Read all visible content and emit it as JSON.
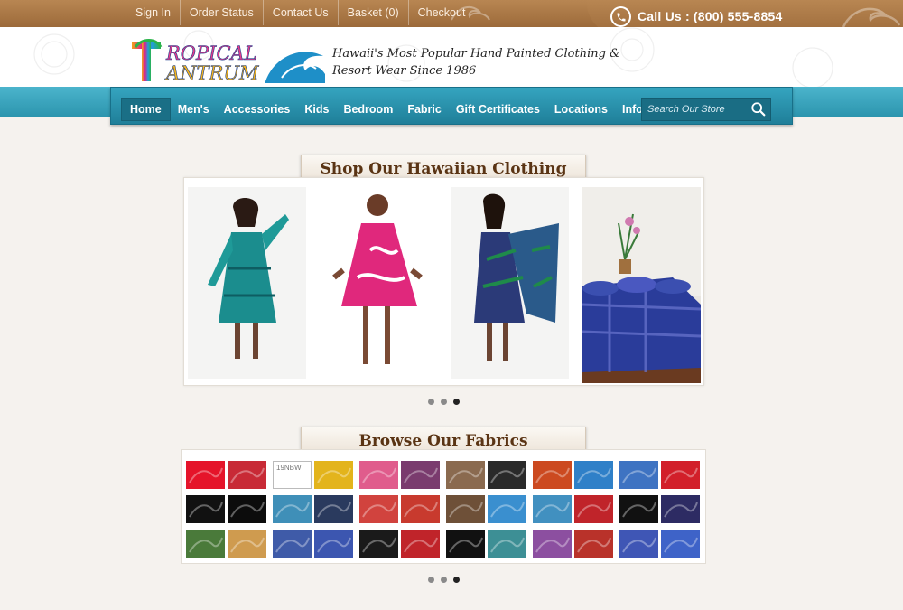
{
  "topbar": {
    "links": [
      "Sign In",
      "Order Status",
      "Contact Us",
      "Basket (0)",
      "Checkout"
    ],
    "call_text": "Call Us : (800) 555-8854"
  },
  "header": {
    "logo_text": "TROPICAL TANTRUM",
    "tagline_line1": "Hawaii's Most Popular Hand Painted Clothing &",
    "tagline_line2": "Resort Wear Since 1986"
  },
  "nav": {
    "items": [
      "Home",
      "Men's",
      "Accessories",
      "Kids",
      "Bedroom",
      "Fabric",
      "Gift Certificates",
      "Locations",
      "Informations"
    ],
    "active": "Home",
    "search_placeholder": "Search Our Store"
  },
  "clothing": {
    "title": "Shop Our Hawaiian Clothing",
    "dots": 3,
    "active_dot": 3
  },
  "fabrics": {
    "title": "Browse Our Fabrics",
    "broken_image_alt": "19NBW",
    "swatch_colors": [
      [
        "#e5142a",
        "#c82a36",
        "#ffffff",
        "#e3b41c",
        "#e05c8c",
        "#7a3b6e",
        "#8a6a4f",
        "#2a2a2a",
        "#cc4a20",
        "#2f80c8",
        "#3e73c2",
        "#d21f2a"
      ],
      [
        "#111111",
        "#0c0c0c",
        "#3f8fb8",
        "#2a3a5e",
        "#d1433e",
        "#c83a2e",
        "#6e5038",
        "#3a8fcf",
        "#4190c0",
        "#c0242a",
        "#111111",
        "#2d2b63"
      ],
      [
        "#4a7a3a",
        "#cf9b4f",
        "#3f5ba8",
        "#3c56b0",
        "#1a1a1a",
        "#c0242a",
        "#111111",
        "#3d8f95",
        "#8c4fa0",
        "#b9322a",
        "#3f56b5",
        "#3e63c8"
      ]
    ]
  },
  "colors": {
    "brown_bar": "#9c6a3a",
    "teal_nav": "#2b94ad",
    "title_brown": "#5a3414",
    "page_bg": "#f5f2ee"
  }
}
